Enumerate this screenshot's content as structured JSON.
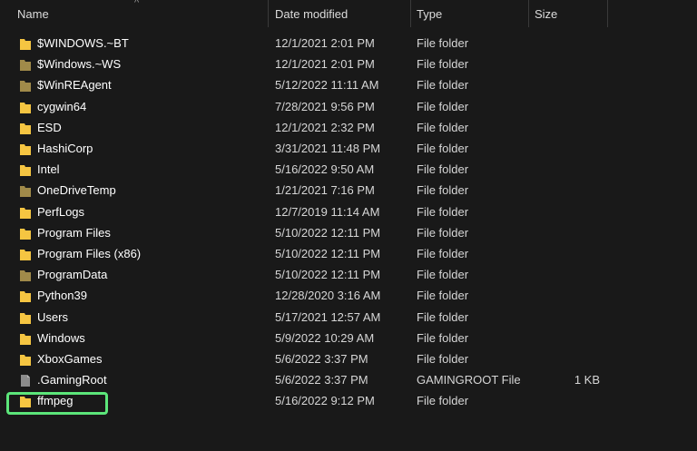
{
  "columns": {
    "name": "Name",
    "date": "Date modified",
    "type": "Type",
    "size": "Size"
  },
  "sort_indicator": "^",
  "colors": {
    "background": "#191919",
    "folder_yellow": "#f5c542",
    "folder_dim": "#a08a4a",
    "highlight_border": "#5ce67a"
  },
  "rows": [
    {
      "name": "$WINDOWS.~BT",
      "date": "12/1/2021 2:01 PM",
      "type": "File folder",
      "size": "",
      "icon": "folder-icon"
    },
    {
      "name": "$Windows.~WS",
      "date": "12/1/2021 2:01 PM",
      "type": "File folder",
      "size": "",
      "icon": "hidden-folder-icon"
    },
    {
      "name": "$WinREAgent",
      "date": "5/12/2022 11:11 AM",
      "type": "File folder",
      "size": "",
      "icon": "hidden-folder-icon"
    },
    {
      "name": "cygwin64",
      "date": "7/28/2021 9:56 PM",
      "type": "File folder",
      "size": "",
      "icon": "folder-icon"
    },
    {
      "name": "ESD",
      "date": "12/1/2021 2:32 PM",
      "type": "File folder",
      "size": "",
      "icon": "folder-icon"
    },
    {
      "name": "HashiCorp",
      "date": "3/31/2021 11:48 PM",
      "type": "File folder",
      "size": "",
      "icon": "folder-icon"
    },
    {
      "name": "Intel",
      "date": "5/16/2022 9:50 AM",
      "type": "File folder",
      "size": "",
      "icon": "folder-icon"
    },
    {
      "name": "OneDriveTemp",
      "date": "1/21/2021 7:16 PM",
      "type": "File folder",
      "size": "",
      "icon": "hidden-folder-icon"
    },
    {
      "name": "PerfLogs",
      "date": "12/7/2019 11:14 AM",
      "type": "File folder",
      "size": "",
      "icon": "folder-icon"
    },
    {
      "name": "Program Files",
      "date": "5/10/2022 12:11 PM",
      "type": "File folder",
      "size": "",
      "icon": "folder-icon"
    },
    {
      "name": "Program Files (x86)",
      "date": "5/10/2022 12:11 PM",
      "type": "File folder",
      "size": "",
      "icon": "folder-icon"
    },
    {
      "name": "ProgramData",
      "date": "5/10/2022 12:11 PM",
      "type": "File folder",
      "size": "",
      "icon": "hidden-folder-icon"
    },
    {
      "name": "Python39",
      "date": "12/28/2020 3:16 AM",
      "type": "File folder",
      "size": "",
      "icon": "folder-icon"
    },
    {
      "name": "Users",
      "date": "5/17/2021 12:57 AM",
      "type": "File folder",
      "size": "",
      "icon": "folder-icon"
    },
    {
      "name": "Windows",
      "date": "5/9/2022 10:29 AM",
      "type": "File folder",
      "size": "",
      "icon": "folder-icon"
    },
    {
      "name": "XboxGames",
      "date": "5/6/2022 3:37 PM",
      "type": "File folder",
      "size": "",
      "icon": "folder-icon"
    },
    {
      "name": ".GamingRoot",
      "date": "5/6/2022 3:37 PM",
      "type": "GAMINGROOT File",
      "size": "1 KB",
      "icon": "file-icon"
    },
    {
      "name": "ffmpeg",
      "date": "5/16/2022 9:12 PM",
      "type": "File folder",
      "size": "",
      "icon": "folder-icon",
      "highlighted": true
    }
  ]
}
